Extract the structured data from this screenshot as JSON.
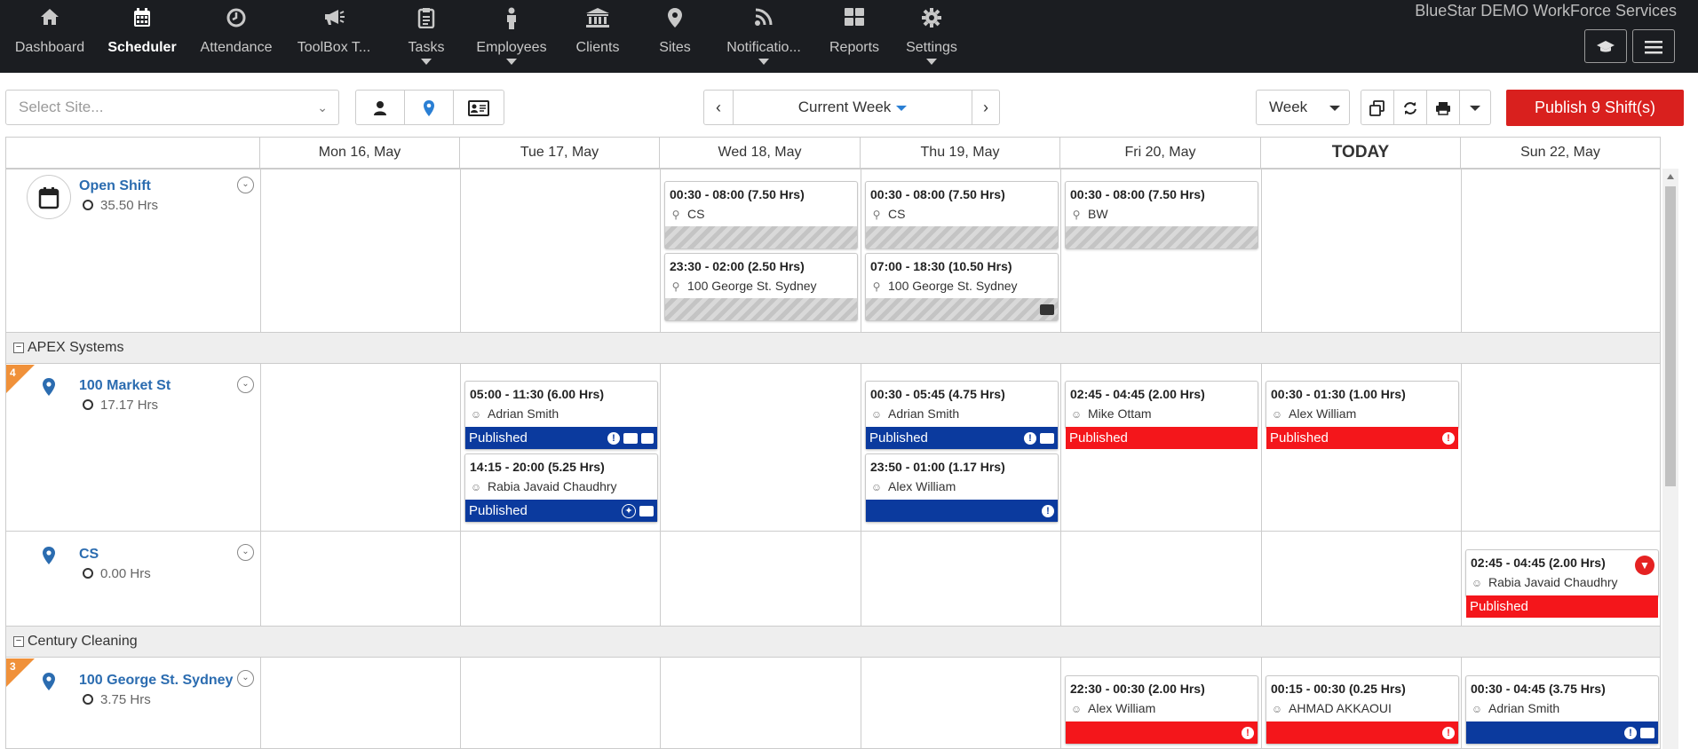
{
  "nav": {
    "items": [
      {
        "label": "Dashboard",
        "icon": "home-icon"
      },
      {
        "label": "Scheduler",
        "icon": "calendar-icon"
      },
      {
        "label": "Attendance",
        "icon": "clock-icon"
      },
      {
        "label": "ToolBox T...",
        "icon": "megaphone-icon"
      },
      {
        "label": "Tasks",
        "icon": "clipboard-icon"
      },
      {
        "label": "Employees",
        "icon": "person-icon"
      },
      {
        "label": "Clients",
        "icon": "bank-icon"
      },
      {
        "label": "Sites",
        "icon": "map-pin-icon"
      },
      {
        "label": "Notificatio...",
        "icon": "rss-icon"
      },
      {
        "label": "Reports",
        "icon": "grid-icon"
      },
      {
        "label": "Settings",
        "icon": "gear-icon"
      }
    ],
    "brand": "BlueStar DEMO WorkForce Services"
  },
  "toolbar": {
    "site_placeholder": "Select Site...",
    "week_label": "Current Week",
    "view_select": "Week",
    "publish_label": "Publish 9 Shift(s)"
  },
  "days": [
    "Mon 16, May",
    "Tue 17, May",
    "Wed 18, May",
    "Thu 19, May",
    "Fri 20, May",
    "TODAY",
    "Sun 22, May"
  ],
  "rows": {
    "open_shift": {
      "title": "Open Shift",
      "hours": "35.50 Hrs"
    },
    "group_apex": "APEX Systems",
    "market_st": {
      "title": "100 Market St",
      "hours": "17.17 Hrs",
      "badge": "4"
    },
    "cs": {
      "title": "CS",
      "hours": "0.00 Hrs"
    },
    "group_century": "Century Cleaning",
    "george_st": {
      "title": "100 George St. Sydney",
      "hours": "3.75 Hrs",
      "badge": "3"
    }
  },
  "shifts": {
    "open_wed_1": {
      "time": "00:30 - 08:00 (7.50 Hrs)",
      "who": "CS"
    },
    "open_wed_2": {
      "time": "23:30 - 02:00 (2.50 Hrs)",
      "who": "100 George St. Sydney"
    },
    "open_thu_1": {
      "time": "00:30 - 08:00 (7.50 Hrs)",
      "who": "CS"
    },
    "open_thu_2": {
      "time": "07:00 - 18:30 (10.50 Hrs)",
      "who": "100 George St. Sydney"
    },
    "open_fri_1": {
      "time": "00:30 - 08:00 (7.50 Hrs)",
      "who": "BW"
    },
    "mkt_tue_1": {
      "time": "05:00 - 11:30 (6.00 Hrs)",
      "who": "Adrian Smith",
      "status": "Published"
    },
    "mkt_tue_2": {
      "time": "14:15 - 20:00 (5.25 Hrs)",
      "who": "Rabia Javaid Chaudhry",
      "status": "Published"
    },
    "mkt_thu_1": {
      "time": "00:30 - 05:45 (4.75 Hrs)",
      "who": "Adrian Smith",
      "status": "Published"
    },
    "mkt_thu_2": {
      "time": "23:50 - 01:00 (1.17 Hrs)",
      "who": "Alex William",
      "status": ""
    },
    "mkt_fri_1": {
      "time": "02:45 - 04:45 (2.00 Hrs)",
      "who": "Mike Ottam",
      "status": "Published"
    },
    "mkt_sat_1": {
      "time": "00:30 - 01:30 (1.00 Hrs)",
      "who": "Alex William",
      "status": "Published"
    },
    "cs_sun_1": {
      "time": "02:45 - 04:45 (2.00 Hrs)",
      "who": "Rabia Javaid Chaudhry",
      "status": "Published"
    },
    "geo_fri_1": {
      "time": "22:30 - 00:30 (2.00 Hrs)",
      "who": "Alex William",
      "status": ""
    },
    "geo_sat_1": {
      "time": "00:15 - 00:30 (0.25 Hrs)",
      "who": "AHMAD AKKAOUI",
      "status": ""
    },
    "geo_sun_1": {
      "time": "00:30 - 04:45 (3.75 Hrs)",
      "who": "Adrian Smith",
      "status": ""
    }
  },
  "colors": {
    "published_blue": "#0b3a9e",
    "alert_red": "#f4161b",
    "publish_button": "#d9201e",
    "nav_bg": "#1b1d21"
  }
}
